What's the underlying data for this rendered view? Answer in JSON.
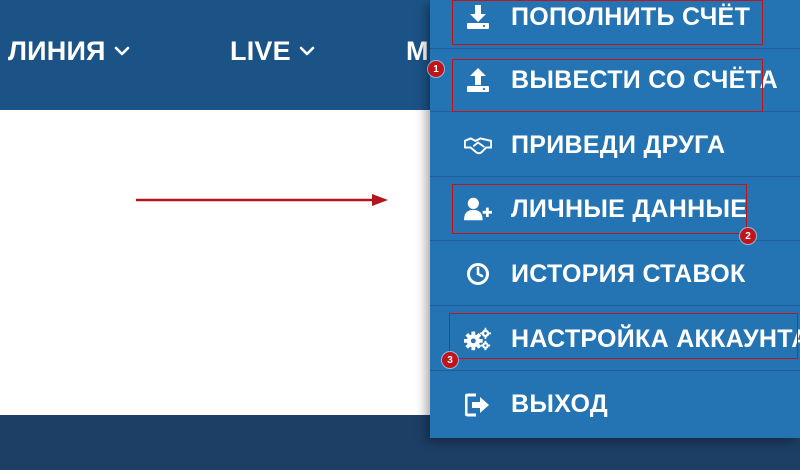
{
  "nav": {
    "items": [
      {
        "label": "ЛИНИЯ",
        "has_chevron": true
      },
      {
        "label": "LIVE",
        "has_chevron": true
      },
      {
        "label": "М",
        "has_chevron": false
      }
    ]
  },
  "menu": {
    "items": [
      {
        "label": "ПОПОЛНИТЬ СЧЁТ",
        "icon": "deposit-icon"
      },
      {
        "label": "ВЫВЕСТИ СО СЧЁТА",
        "icon": "withdraw-icon"
      },
      {
        "label": "ПРИВЕДИ ДРУГА",
        "icon": "handshake-icon"
      },
      {
        "label": "ЛИЧНЫЕ ДАННЫЕ",
        "icon": "user-add-icon"
      },
      {
        "label": "ИСТОРИЯ СТАВОК",
        "icon": "clock-icon"
      },
      {
        "label": "НАСТРОЙКА АККАУНТА",
        "icon": "gears-icon"
      },
      {
        "label": "ВЫХОД",
        "icon": "logout-icon"
      }
    ]
  },
  "annotations": {
    "badges": [
      "1",
      "2",
      "3"
    ],
    "highlight_color": "#c0141b"
  },
  "colors": {
    "topbar": "#1c5387",
    "menu": "#2474b4",
    "footer": "#1d3f66"
  }
}
